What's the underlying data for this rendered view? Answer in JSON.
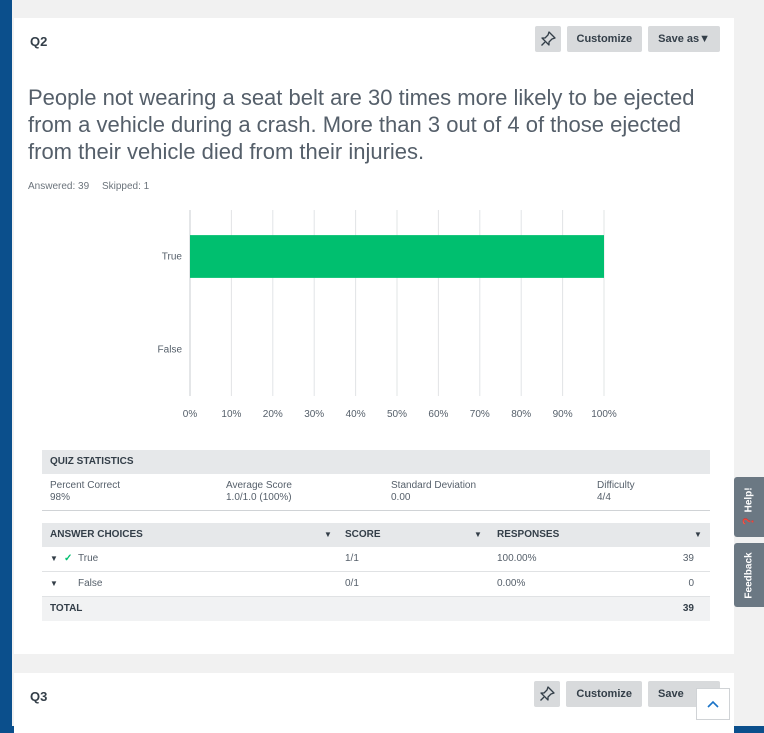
{
  "q2": {
    "label": "Q2",
    "toolbar": {
      "customize_label": "Customize",
      "save_as_label": "Save as▼"
    },
    "question_text": "People not wearing a seat belt are 30 times more likely to be ejected from a vehicle during a crash. More than 3 out of 4 of those ejected from their vehicle died from their injuries.",
    "answered": "Answered: 39",
    "skipped": "Skipped: 1"
  },
  "chart_data": {
    "type": "bar",
    "orientation": "horizontal",
    "categories": [
      "True",
      "False"
    ],
    "values": [
      100,
      0
    ],
    "xlim": [
      0,
      100
    ],
    "x_ticks": [
      "0%",
      "10%",
      "20%",
      "30%",
      "40%",
      "50%",
      "60%",
      "70%",
      "80%",
      "90%",
      "100%"
    ],
    "bar_color": "#00bf6f",
    "grid": true
  },
  "quiz_statistics": {
    "heading": "QUIZ STATISTICS",
    "columns": [
      {
        "label": "Percent Correct",
        "value": "98%"
      },
      {
        "label": "Average Score",
        "value": "1.0/1.0 (100%)"
      },
      {
        "label": "Standard Deviation",
        "value": "0.00"
      },
      {
        "label": "Difficulty",
        "value": "4/4"
      }
    ]
  },
  "answer_table": {
    "headers": {
      "choices": "ANSWER CHOICES",
      "score": "SCORE",
      "responses": "RESPONSES"
    },
    "rows": [
      {
        "choice": "True",
        "correct": true,
        "score": "1/1",
        "percent": "100.00%",
        "count": "39"
      },
      {
        "choice": "False",
        "correct": false,
        "score": "0/1",
        "percent": "0.00%",
        "count": "0"
      }
    ],
    "total": {
      "label": "TOTAL",
      "count": "39"
    }
  },
  "q3": {
    "label": "Q3",
    "toolbar": {
      "customize_label": "Customize",
      "save_as_label": "Save"
    }
  },
  "side_tabs": {
    "help": "Help!",
    "feedback": "Feedback"
  },
  "colors": {
    "accent_green": "#00bf6f",
    "page_frame": "#0b4f8c",
    "side_tab": "#6b7883"
  }
}
